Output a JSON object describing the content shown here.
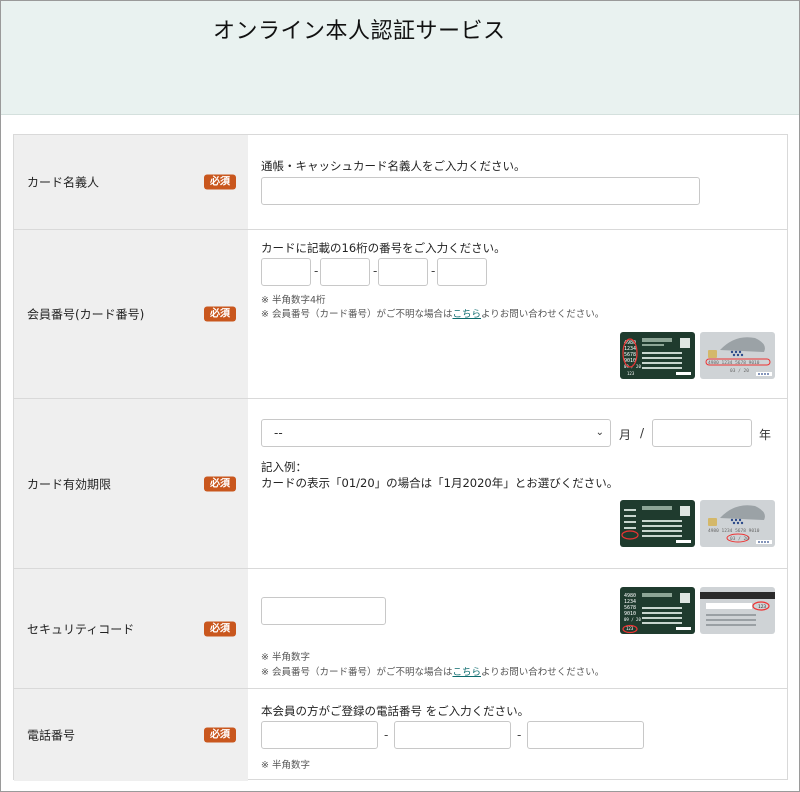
{
  "header": {
    "title": "オンライン本人認証サービス"
  },
  "required_label": "必須",
  "rows": {
    "cardholder": {
      "label": "カード名義人",
      "instruction": "通帳・キャッシュカード名義人をご入力ください。",
      "value": ""
    },
    "member_no": {
      "label": "会員番号(カード番号)",
      "instruction": "カードに記載の16桁の番号をご入力ください。",
      "separator": "-",
      "note1": "※ 半角数字4桁",
      "note2_prefix": "※ 会員番号（カード番号）がご不明な場合は",
      "note2_link": "こちら",
      "note2_suffix": "よりお問い合わせください。",
      "card_front_numbers": [
        "4980",
        "1234",
        "5678",
        "9010"
      ],
      "card_front_exp": "09 / 20",
      "card_front_cvv": "123",
      "card_silver_number": "4980 1234 5678 9010",
      "card_silver_exp": "03 / 20"
    },
    "expiry": {
      "label": "カード有効期限",
      "month_selected": "--",
      "month_unit": "月",
      "slash": "/",
      "year_unit": "年",
      "example_title": "記入例：",
      "example_text": "カードの表示「01/20」の場合は「1月2020年」とお選びください。",
      "card_silver_number": "4980 1234 5678 9010",
      "card_silver_exp": "03 / 20"
    },
    "security": {
      "label": "セキュリティコード",
      "note1": "※ 半角数字",
      "note2_prefix": "※ 会員番号（カード番号）がご不明な場合は",
      "note2_link": "こちら",
      "note2_suffix": "よりお問い合わせください。",
      "card_front_numbers": [
        "4980",
        "1234",
        "5678",
        "9010"
      ],
      "card_front_exp": "09 / 20",
      "card_front_cvv": "123",
      "card_back_cvv": "123"
    },
    "phone": {
      "label": "電話番号",
      "instruction": "本会員の方がご登録の電話番号 をご入力ください。",
      "separator": "-",
      "note1": "※ 半角数字"
    }
  },
  "colors": {
    "header_bg": "#e9f2f0",
    "required_badge": "#c9571e",
    "card_dark": "#1f3b2e",
    "card_silver": "#cfd3d6",
    "link": "#0d6b6e"
  }
}
